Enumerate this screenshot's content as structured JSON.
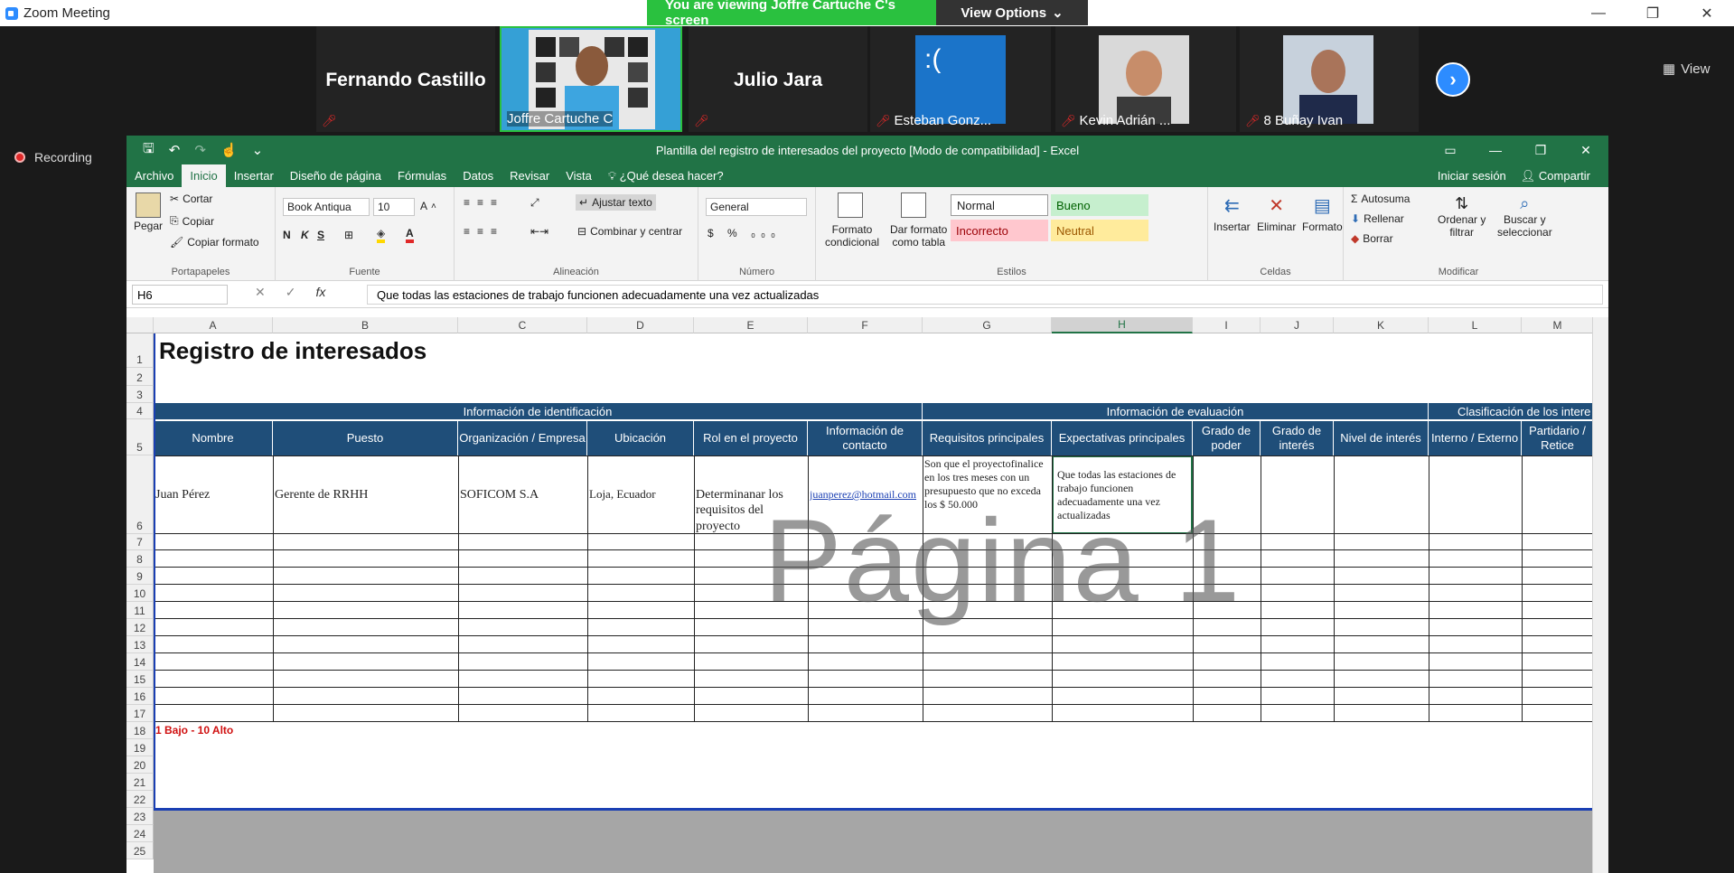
{
  "zoom": {
    "window_title": "Zoom Meeting",
    "share_banner": "You are viewing Joffre Cartuche C's screen",
    "view_options": "View Options",
    "view_button": "View",
    "recording": "Recording",
    "participants": [
      {
        "name": "Fernando Castillo",
        "label": ""
      },
      {
        "name": "",
        "label": "Joffre Cartuche C"
      },
      {
        "name": "Julio Jara",
        "label": ""
      },
      {
        "name": "",
        "label": "Esteban Gonz..."
      },
      {
        "name": "",
        "label": "Kevin Adrián ..."
      },
      {
        "name": "",
        "label": "8 Buñay Ivan"
      }
    ]
  },
  "excel": {
    "title": "Plantilla del registro de interesados del proyecto  [Modo de compatibilidad] - Excel",
    "tabs": [
      "Archivo",
      "Inicio",
      "Insertar",
      "Diseño de página",
      "Fórmulas",
      "Datos",
      "Revisar",
      "Vista"
    ],
    "tell_me": "¿Qué desea hacer?",
    "sign_in": "Iniciar sesión",
    "share": "Compartir",
    "ribbon": {
      "paste": "Pegar",
      "cut": "Cortar",
      "copy": "Copiar",
      "copy_format": "Copiar formato",
      "clipboard": "Portapapeles",
      "font_name": "Book Antiqua",
      "font_size": "10",
      "font_group": "Fuente",
      "bold": "N",
      "italic": "K",
      "underline": "S",
      "wrap": "Ajustar texto",
      "merge": "Combinar y centrar",
      "alignment": "Alineación",
      "number_format": "General",
      "number": "Número",
      "cond_format_1": "Formato",
      "cond_format_2": "condicional",
      "table_format_1": "Dar formato",
      "table_format_2": "como tabla",
      "style_normal": "Normal",
      "style_bueno": "Bueno",
      "style_incorrecto": "Incorrecto",
      "style_neutral": "Neutral",
      "styles": "Estilos",
      "insert": "Insertar",
      "delete": "Eliminar",
      "format": "Formato",
      "cells": "Celdas",
      "autosum": "Autosuma",
      "fill": "Rellenar",
      "clear": "Borrar",
      "sort_1": "Ordenar y",
      "sort_2": "filtrar",
      "find_1": "Buscar y",
      "find_2": "seleccionar",
      "modify": "Modificar"
    },
    "namebox": "H6",
    "formula": "Que todas las estaciones de trabajo funcionen adecuadamente una vez actualizadas",
    "columns": [
      "A",
      "B",
      "C",
      "D",
      "E",
      "F",
      "G",
      "H",
      "I",
      "J",
      "K",
      "L",
      "M"
    ],
    "rows": [
      "1",
      "2",
      "3",
      "4",
      "5",
      "6",
      "7",
      "8",
      "9",
      "10",
      "11",
      "12",
      "13",
      "14",
      "15",
      "16",
      "17",
      "18",
      "19",
      "20",
      "21",
      "22",
      "23",
      "24",
      "25"
    ],
    "sheet_title": "Registro de interesados",
    "band_identificacion": "Información de identificación",
    "band_evaluacion": "Información de evaluación",
    "band_clasificacion": "Clasificación de los intere",
    "headers": [
      "Nombre",
      "Puesto",
      "Organización / Empresa",
      "Ubicación",
      "Rol en el proyecto",
      "Información de contacto",
      "Requisitos principales",
      "Expectativas principales",
      "Grado de poder",
      "Grado de interés",
      "Nivel de interés",
      "Interno / Externo",
      "Partidario / Retice"
    ],
    "row6": {
      "nombre": "Juan Pérez",
      "puesto": "Gerente de RRHH",
      "organizacion": "SOFICOM S.A",
      "ubicacion": "Loja, Ecuador",
      "rol": "Determinanar los requisitos del proyecto",
      "contacto": "juanperez@hotmail.com",
      "requisitos": "Son que el proyectofinalice en los tres meses con un presupuesto que no exceda los $ 50.000",
      "expectativas": "Que todas las estaciones de trabajo funcionen adecuadamente una vez actualizadas"
    },
    "note": "1 Bajo - 10 Alto",
    "watermark": "Página 1"
  }
}
